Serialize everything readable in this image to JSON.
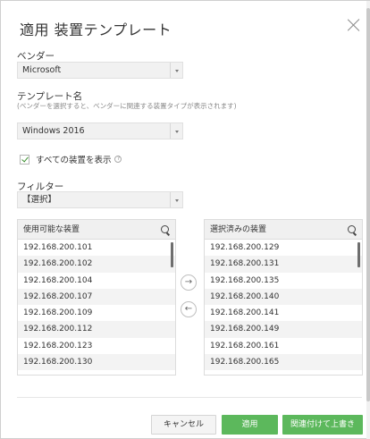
{
  "dialog": {
    "title": "適用 装置テンプレート"
  },
  "vendor": {
    "label": "ベンダー",
    "selected": "Microsoft"
  },
  "template": {
    "label": "テンプレート名",
    "hint": "(ベンダーを選択すると、ベンダーに関連する装置タイプが表示されます)",
    "selected": "Windows 2016"
  },
  "show_all": {
    "label": "すべての装置を表示",
    "checked": true,
    "help": "?"
  },
  "filter": {
    "label": "フィルター",
    "selected": "【選択】"
  },
  "available": {
    "header": "使用可能な装置",
    "items": [
      "192.168.200.101",
      "192.168.200.102",
      "192.168.200.104",
      "192.168.200.107",
      "192.168.200.109",
      "192.168.200.112",
      "192.168.200.123",
      "192.168.200.130"
    ]
  },
  "selected_devices": {
    "header": "選択済みの装置",
    "items": [
      "192.168.200.129",
      "192.168.200.131",
      "192.168.200.135",
      "192.168.200.140",
      "192.168.200.141",
      "192.168.200.149",
      "192.168.200.161",
      "192.168.200.165"
    ]
  },
  "transfer": {
    "add": "→",
    "remove": "←"
  },
  "buttons": {
    "cancel": "キャンセル",
    "apply": "適用",
    "associate_overwrite": "関連付けて上書き"
  },
  "colors": {
    "accent": "#5cb85c",
    "check": "#3a8f2e"
  }
}
